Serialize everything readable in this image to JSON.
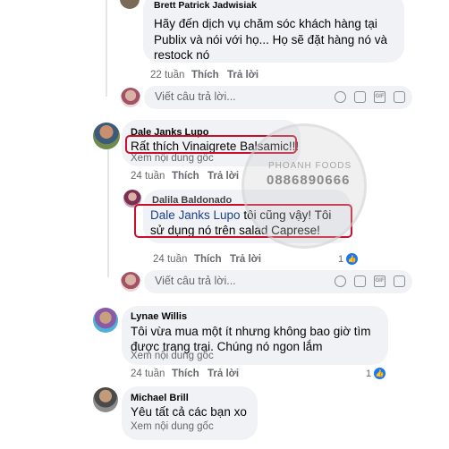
{
  "comments": [
    {
      "id": "brett",
      "author": "Brett Patrick Jadwisiak",
      "text": "Hãy đến dịch vụ chăm sóc khách hàng tại Publix và nói với họ... Họ sẽ đặt hàng nó và restock nó",
      "time": "22 tuần",
      "like_label": "Thích",
      "reply_label": "Trả lời"
    },
    {
      "id": "dale",
      "author": "Dale Janks Lupo",
      "text": "Rất thích Vinaigrete Balsamic!!!",
      "see_original": "Xem nội dung gốc",
      "time": "24 tuần",
      "like_label": "Thích",
      "reply_label": "Trả lời"
    },
    {
      "id": "dalila",
      "author": "Dalila Baldonado",
      "mention": "Dale Janks Lupo",
      "text": " tôi cũng vậy! Tôi sử dụng nó trên salad Caprese!",
      "time": "24 tuần",
      "like_label": "Thích",
      "reply_label": "Trả lời",
      "reaction_count": "1"
    },
    {
      "id": "lynae",
      "author": "Lynae Willis",
      "text": "Tôi vừa mua một ít nhưng không bao giờ tìm được trang trại. Chúng nó ngon lắm",
      "see_original": "Xem nội dung gốc",
      "time": "24 tuần",
      "like_label": "Thích",
      "reply_label": "Trả lời",
      "reaction_count": "1"
    },
    {
      "id": "michael",
      "author": "Michael Brill",
      "text": "Yêu tất cả các bạn xo",
      "see_original": "Xem nội dung gốc"
    }
  ],
  "see_original_top": "Xem nội dung gốc",
  "reply_placeholder": "Viết câu trả lời...",
  "watermark": {
    "brand": "PHOANH FOODS",
    "phone": "0886890666"
  },
  "colors": {
    "highlight": "#c8102e",
    "bubble": "#f0f2f5",
    "meta_text": "#65676b",
    "like_blue": "#1877f2"
  }
}
